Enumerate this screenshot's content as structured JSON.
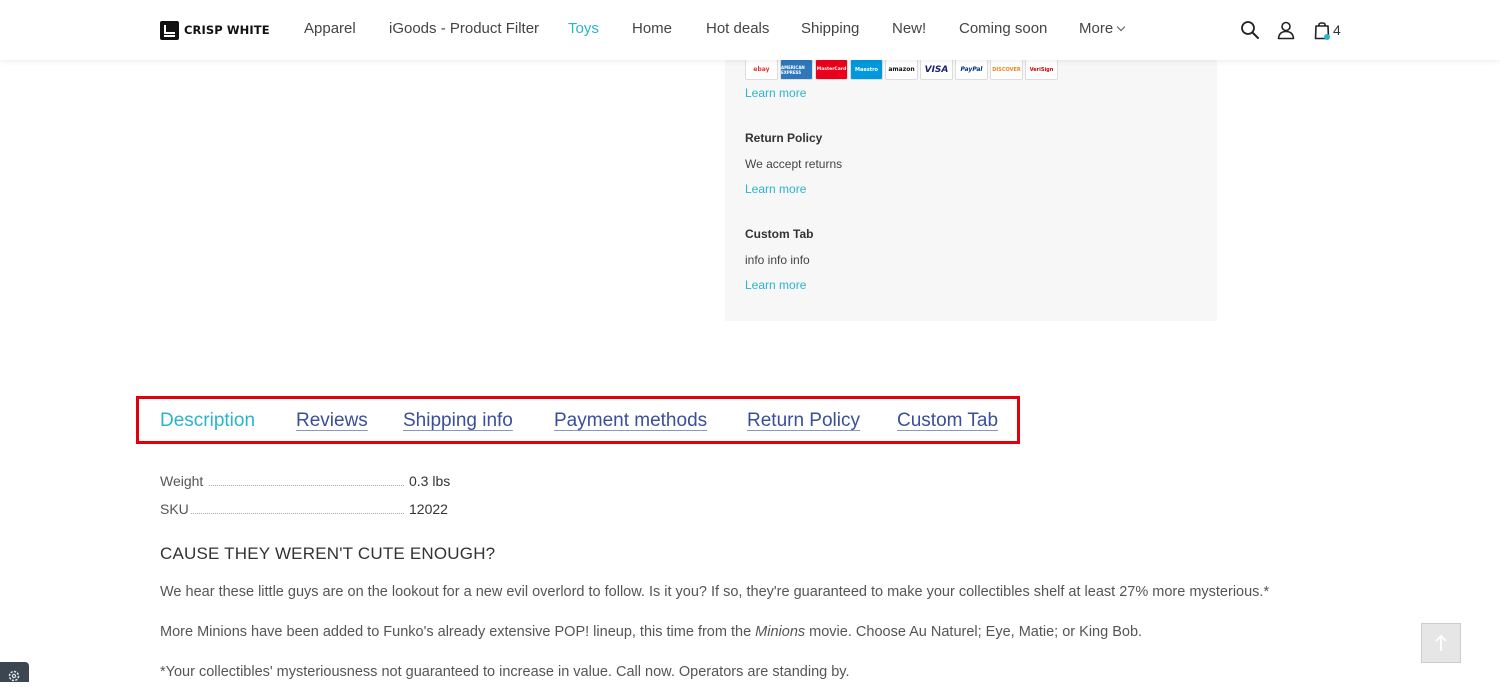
{
  "header": {
    "logo": "CRISP WHITE",
    "nav": [
      "Apparel",
      "iGoods - Product Filter",
      "Toys",
      "Home",
      "Hot deals",
      "Shipping",
      "New!",
      "Coming soon",
      "More"
    ],
    "active_nav": "Toys",
    "cart_count": "4",
    "icons": [
      "search-icon",
      "user-icon",
      "cart-icon"
    ],
    "accent_color": "#2bb3d0"
  },
  "panel": {
    "payment_cards": [
      "ebay",
      "AMERICAN EXPRESS",
      "MasterCard",
      "Maestro",
      "amazon",
      "VISA",
      "PayPal",
      "DISCOVER",
      "VeriSign"
    ],
    "payment_learn_more": "Learn more",
    "return_title": "Return Policy",
    "return_text": "We accept returns",
    "return_learn_more": "Learn more",
    "custom_title": "Custom Tab",
    "custom_text": "info info info",
    "custom_learn_more": "Learn more"
  },
  "tabs": [
    "Description",
    "Reviews",
    "Shipping info",
    "Payment methods",
    "Return Policy",
    "Custom Tab"
  ],
  "active_tab": "Description",
  "specs": [
    {
      "label": "Weight",
      "value": "0.3 lbs"
    },
    {
      "label": "SKU",
      "value": "12022"
    }
  ],
  "description": {
    "heading": "CAUSE THEY WEREN'T CUTE ENOUGH?",
    "p1": "We hear these little guys are on the lookout for a new evil overlord to follow. Is it you? If so, they're guaranteed to make your collectibles shelf at least 27% more mysterious.*",
    "p2_before": "More Minions have been added to Funko's already extensive POP! lineup, this time from the ",
    "p2_em": "Minions",
    "p2_after": " movie. Choose Au Naturel; Eye, Matie; or King Bob.",
    "p3": "*Your collectibles' mysteriousness not guaranteed to increase in value. Call now. Operators are standing by."
  }
}
